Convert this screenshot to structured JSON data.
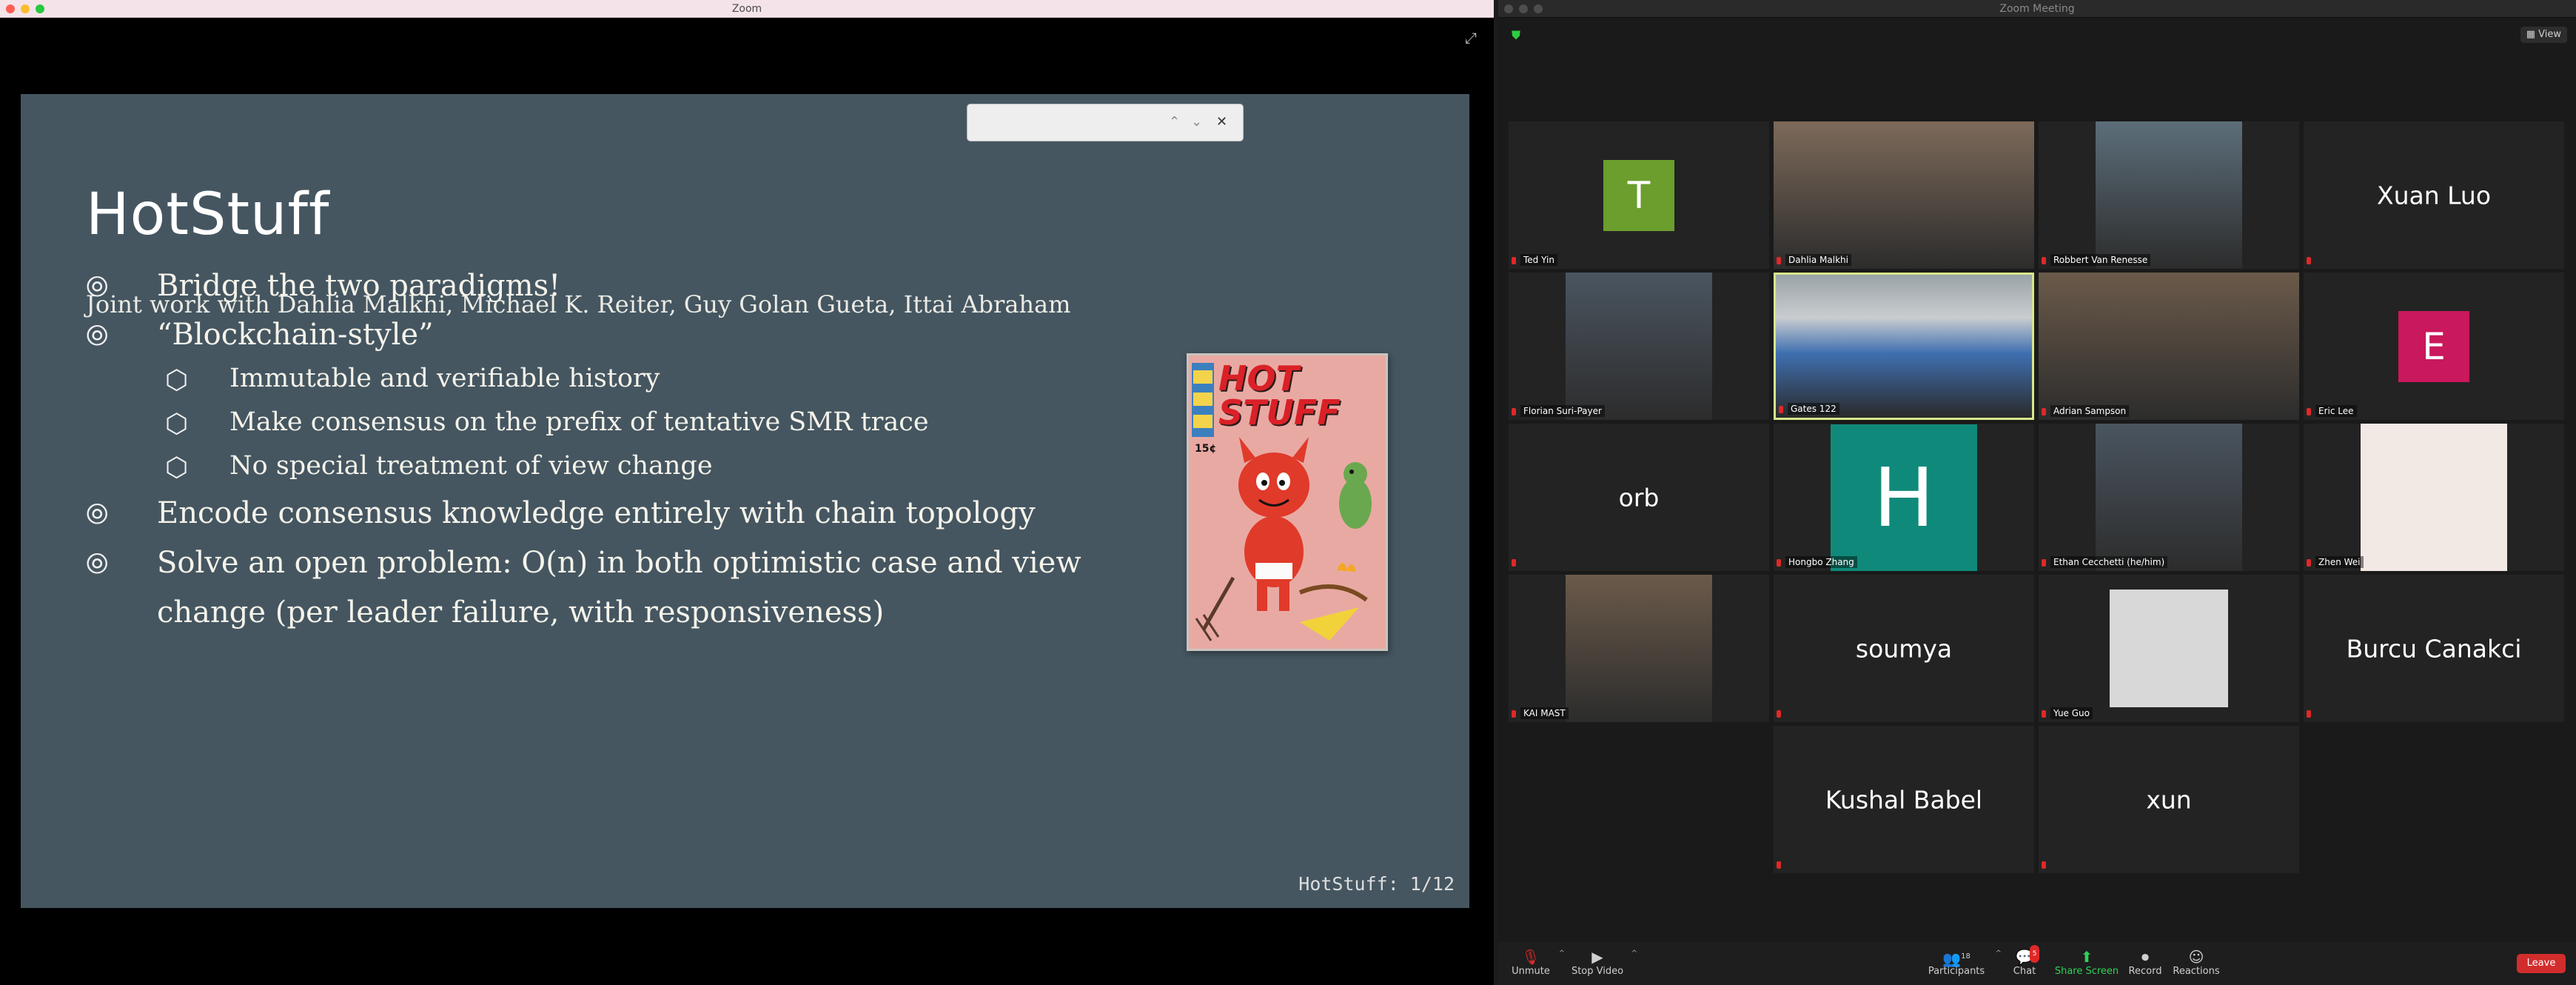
{
  "left_window": {
    "title": "Zoom"
  },
  "slide": {
    "title": "HotStuff",
    "subtitle": "Joint work with Dahlia Malkhi, Michael K. Reiter, Guy Golan Gueta, Ittai Abraham",
    "bullets": [
      {
        "level": 1,
        "mark": "⦾",
        "text": "Bridge the two paradigms!"
      },
      {
        "level": 1,
        "mark": "⦾",
        "text": "“Blockchain-style”"
      },
      {
        "level": 2,
        "mark": "⬡",
        "text": "Immutable and verifiable history"
      },
      {
        "level": 2,
        "mark": "⬡",
        "text": "Make consensus on the prefix of tentative SMR trace"
      },
      {
        "level": 2,
        "mark": "⬡",
        "text": "No special treatment of view change"
      },
      {
        "level": 1,
        "mark": "⦾",
        "text": "Encode consensus knowledge entirely with chain topology"
      },
      {
        "level": 1,
        "mark": "⦾",
        "text": "Solve an open problem: O(n) in both optimistic case and view"
      },
      {
        "level": 1,
        "mark": "",
        "text": "change (per leader failure, with responsiveness)"
      }
    ],
    "comic_title_line1": "HOT",
    "comic_title_line2": "STUFF",
    "comic_price": "15¢",
    "footer": "HotStuff: 1/12"
  },
  "find_bar": {
    "value": "",
    "up": "⌃",
    "down": "⌄",
    "close": "✕"
  },
  "right_window": {
    "title": "Zoom Meeting",
    "view_label": "View"
  },
  "participants": [
    {
      "name": "Ted Yin",
      "type": "avatar",
      "letter": "T",
      "color": "#6b9e2d"
    },
    {
      "name": "Dahlia Malkhi",
      "type": "video"
    },
    {
      "name": "Robbert Van Renesse",
      "type": "video"
    },
    {
      "name": "",
      "type": "bigname",
      "display": "Xuan Luo"
    },
    {
      "name": "Florian Suri-Payer",
      "type": "video"
    },
    {
      "name": "Gates 122",
      "type": "video",
      "active": true
    },
    {
      "name": "Adrian Sampson",
      "type": "video"
    },
    {
      "name": "Eric Lee",
      "type": "avatar",
      "letter": "E",
      "color": "#c9185c"
    },
    {
      "name": "",
      "type": "bigname",
      "display": "orb"
    },
    {
      "name": "Hongbo Zhang",
      "type": "avatar-large",
      "letter": "H",
      "color": "#0f8a7a"
    },
    {
      "name": "Ethan Cecchetti (he/him)",
      "type": "video"
    },
    {
      "name": "Zhen Wei",
      "type": "image"
    },
    {
      "name": "KAI MAST",
      "type": "video"
    },
    {
      "name": "",
      "type": "bigname",
      "display": "soumya"
    },
    {
      "name": "Yue Guo",
      "type": "image"
    },
    {
      "name": "",
      "type": "bigname",
      "display": "Burcu Canakci"
    },
    {
      "name": "",
      "type": "bigname",
      "display": "Kushal Babel"
    },
    {
      "name": "",
      "type": "bigname",
      "display": "xun"
    }
  ],
  "toolbar": {
    "unmute": "Unmute",
    "stop_video": "Stop Video",
    "participants": "Participants",
    "participants_count": "18",
    "chat": "Chat",
    "chat_badge": "5",
    "share_screen": "Share Screen",
    "record": "Record",
    "reactions": "Reactions",
    "leave": "Leave"
  },
  "colors": {
    "slide_bg": "#455661",
    "share_green": "#2fd159",
    "leave_red": "#d22d2d",
    "active_border": "#d8e68a"
  }
}
